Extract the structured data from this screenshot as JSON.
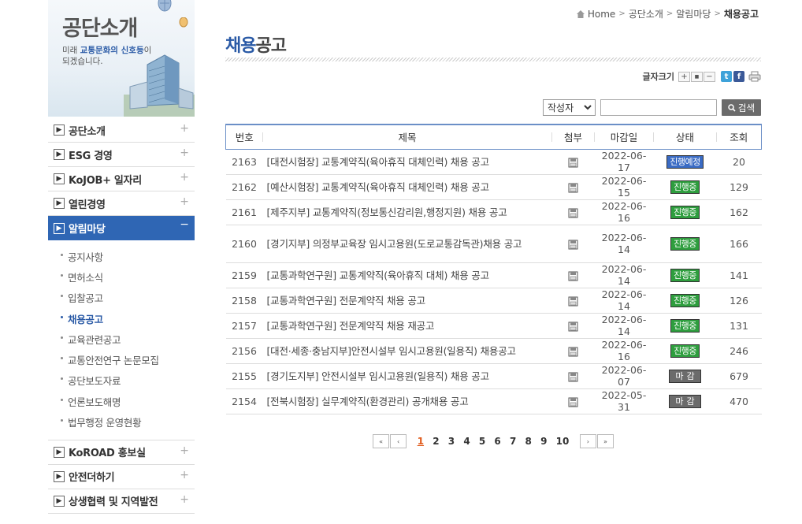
{
  "sidebar": {
    "banner": {
      "title": "공단소개",
      "sub_line1_pre": "미래 ",
      "sub_line1_hl": "교통문화의 신호등",
      "sub_line1_post": "이",
      "sub_line2": "되겠습니다."
    },
    "menu": [
      {
        "label": "공단소개"
      },
      {
        "label": "ESG 경영"
      },
      {
        "label": "KoJOB+ 일자리"
      },
      {
        "label": "열린경영"
      },
      {
        "label": "알림마당",
        "active": true
      }
    ],
    "submenu": [
      {
        "label": "공지사항"
      },
      {
        "label": "면허소식"
      },
      {
        "label": "입찰공고"
      },
      {
        "label": "채용공고",
        "current": true
      },
      {
        "label": "교육관련공고"
      },
      {
        "label": "교통안전연구 논문모집"
      },
      {
        "label": "공단보도자료"
      },
      {
        "label": "언론보도해명"
      },
      {
        "label": "법무행정 운영현황"
      }
    ],
    "menu2": [
      {
        "label": "KoROAD 홍보실"
      },
      {
        "label": "안전더하기"
      },
      {
        "label": "상생협력 및 지역발전"
      }
    ],
    "plus_sign": "+",
    "minus_sign": "−"
  },
  "breadcrumb": {
    "home": "Home",
    "items": [
      "공단소개",
      "알림마당"
    ],
    "current": "채용공고",
    "sep": ">"
  },
  "page_title": {
    "highlight": "채용",
    "rest": "공고"
  },
  "font_tools": {
    "label": "글자크기",
    "plus": "+",
    "reset": "■",
    "minus": "−",
    "twitter": "t",
    "facebook": "f"
  },
  "search": {
    "select_value": "작성자",
    "input_value": "",
    "button_label": "검색"
  },
  "table": {
    "headers": [
      "번호",
      "제목",
      "첨부",
      "마감일",
      "상태",
      "조회"
    ],
    "rows": [
      {
        "no": "2163",
        "subject": "[대전시험장] 교통계약직(육아휴직 대체인력) 채용 공고",
        "deadline": "2022-06-17",
        "status": "진행예정",
        "views": "20"
      },
      {
        "no": "2162",
        "subject": "[예산시험장] 교통계약직(육아휴직 대체인력) 채용 공고",
        "deadline": "2022-06-15",
        "status": "진행중",
        "views": "129"
      },
      {
        "no": "2161",
        "subject": "[제주지부] 교통계약직(정보통신감리원,행정지원) 채용 공고",
        "deadline": "2022-06-16",
        "status": "진행중",
        "views": "162"
      },
      {
        "no": "2160",
        "subject": "[경기지부] 의정부교육장 임시고용원(도로교통감독관)채용 공고",
        "deadline": "2022-06-14",
        "status": "진행중",
        "views": "166"
      },
      {
        "no": "2159",
        "subject": "[교통과학연구원] 교통계약직(육아휴직 대체) 채용 공고",
        "deadline": "2022-06-14",
        "status": "진행중",
        "views": "141"
      },
      {
        "no": "2158",
        "subject": "[교통과학연구원] 전문계약직 채용 공고",
        "deadline": "2022-06-14",
        "status": "진행중",
        "views": "126"
      },
      {
        "no": "2157",
        "subject": "[교통과학연구원] 전문계약직 채용 재공고",
        "deadline": "2022-06-14",
        "status": "진행중",
        "views": "131"
      },
      {
        "no": "2156",
        "subject": "[대전·세종·충남지부]안전시설부 임시고용원(일용직) 채용공고",
        "deadline": "2022-06-16",
        "status": "진행중",
        "views": "246"
      },
      {
        "no": "2155",
        "subject": "[경기도지부] 안전시설부 임시고용원(일용직) 채용 공고",
        "deadline": "2022-06-07",
        "status": "마감",
        "views": "679"
      },
      {
        "no": "2154",
        "subject": "[전북시험장] 실무계약직(환경관리) 공개채용 공고",
        "deadline": "2022-05-31",
        "status": "마감",
        "views": "470"
      }
    ]
  },
  "pagination": {
    "pages": [
      "1",
      "2",
      "3",
      "4",
      "5",
      "6",
      "7",
      "8",
      "9",
      "10"
    ],
    "current": "1",
    "first": "«",
    "prev": "‹",
    "next": "›",
    "last": "»"
  }
}
